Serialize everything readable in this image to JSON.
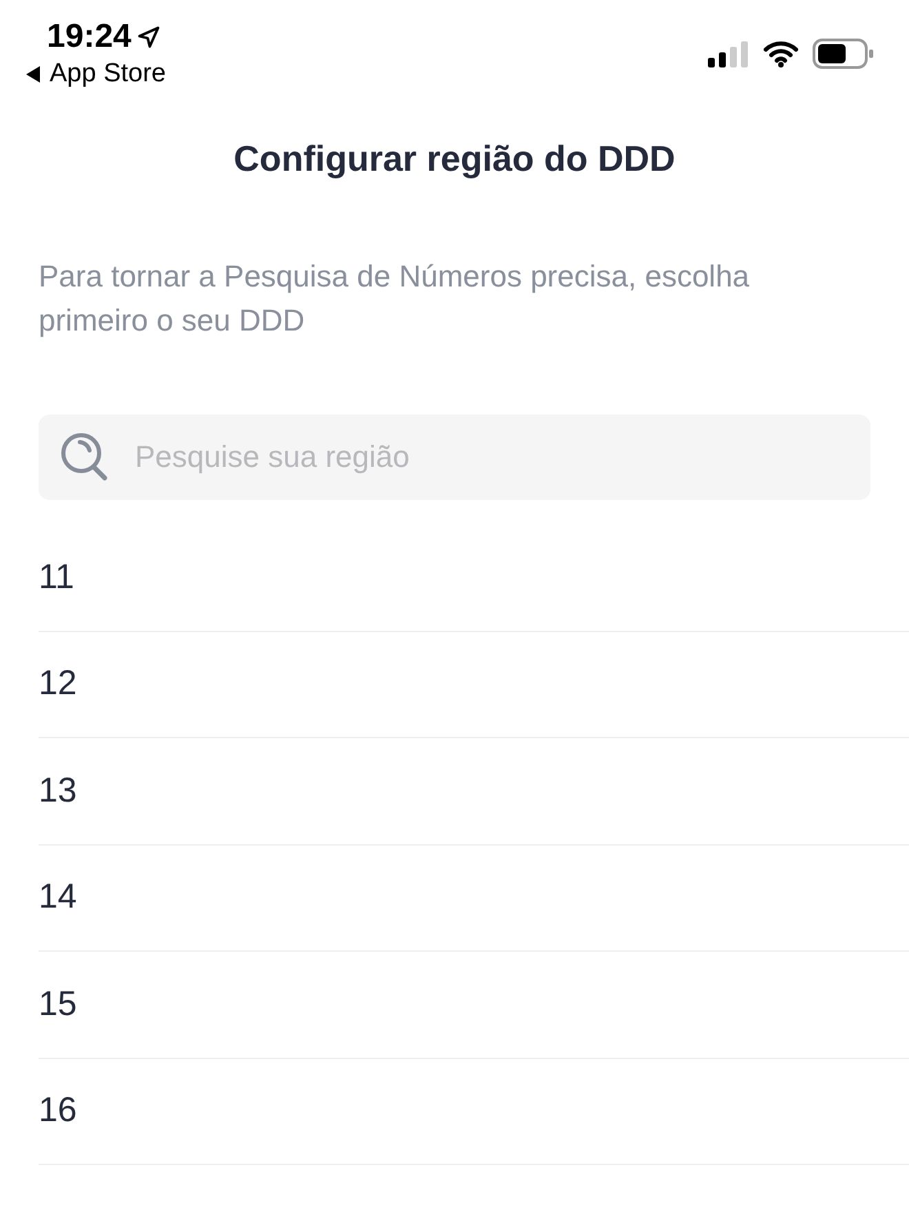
{
  "status_bar": {
    "time": "19:24",
    "back_label": "App Store"
  },
  "title": "Configurar região do DDD",
  "description": "Para tornar a Pesquisa de Números precisa, escolha primeiro o seu DDD",
  "search": {
    "placeholder": "Pesquise sua região"
  },
  "codes": [
    "11",
    "12",
    "13",
    "14",
    "15",
    "16"
  ]
}
